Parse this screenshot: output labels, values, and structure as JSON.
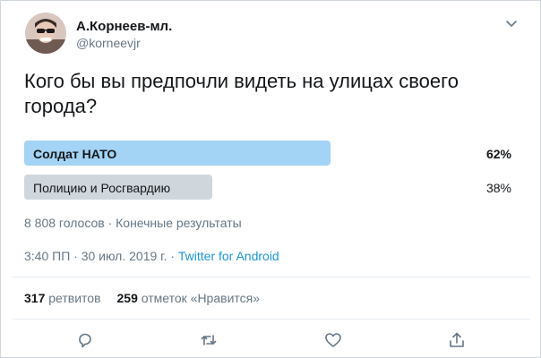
{
  "author": {
    "display_name": "А.Корнеев-мл.",
    "handle": "@korneevjr"
  },
  "tweet": {
    "text": "Кого бы вы предпочли видеть на улицах своего города?"
  },
  "poll": {
    "options": [
      {
        "label": "Солдат НАТО",
        "percent_text": "62%",
        "percent": 62,
        "winner": true,
        "bar_color": "#a3d3f5"
      },
      {
        "label": "Полицию и Росгвардию",
        "percent_text": "38%",
        "percent": 38,
        "winner": false,
        "bar_color": "#cfd6dc"
      }
    ],
    "meta": "8 808 голосов · Конечные результаты"
  },
  "timestamp": {
    "time_date": "3:40 ПП · 30 июл. 2019 г. · ",
    "source": "Twitter for Android"
  },
  "stats": {
    "retweets_count": "317",
    "retweets_label": "ретвитов",
    "likes_count": "259",
    "likes_label": "отметок «Нравится»"
  },
  "colors": {
    "accent": "#1b95e0",
    "secondary_text": "#657786",
    "icon": "#657786"
  },
  "actions": [
    "reply-icon",
    "retweet-icon",
    "like-icon",
    "share-icon"
  ]
}
